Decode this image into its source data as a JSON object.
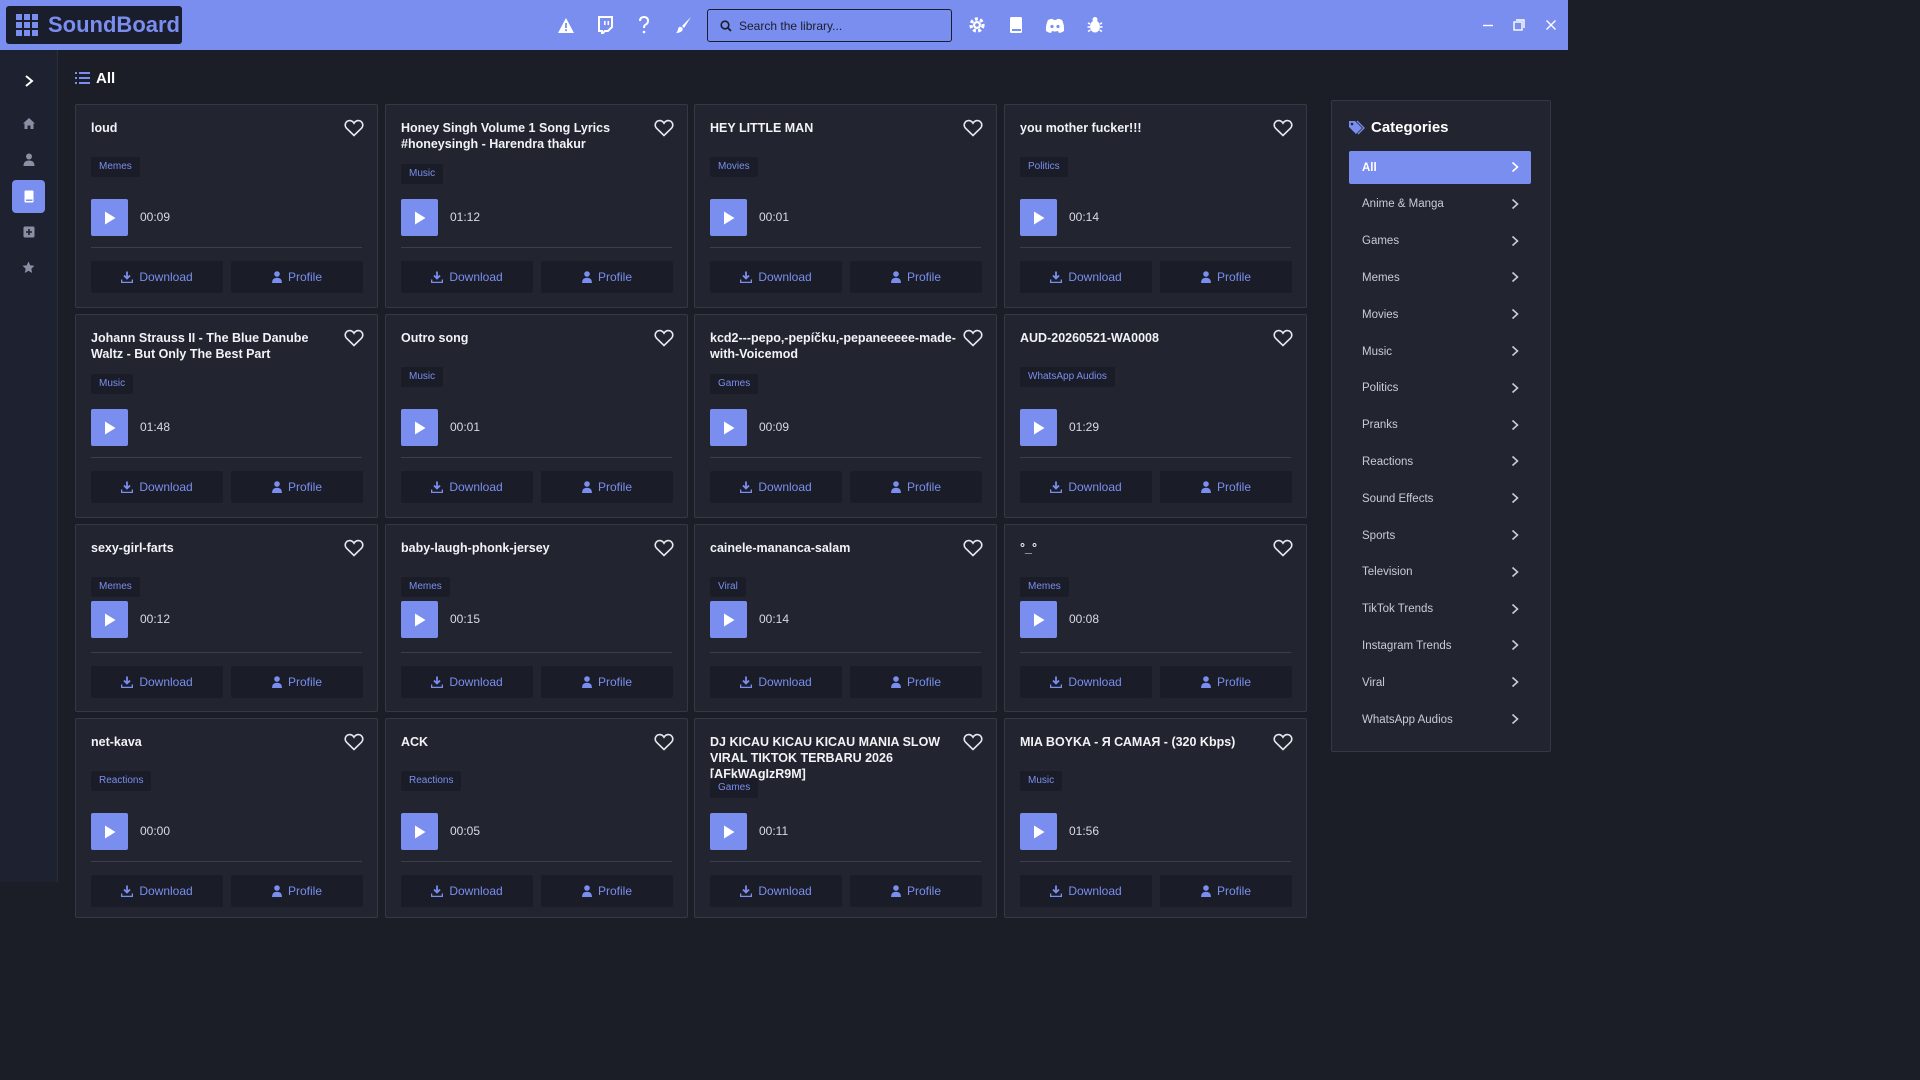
{
  "app": {
    "name": "SoundBoard"
  },
  "toolbar": {
    "icons": [
      "warning-icon",
      "twitch-icon",
      "help-icon",
      "brush-icon",
      "settings-icon",
      "book-icon",
      "discord-icon",
      "bug-icon"
    ],
    "search_placeholder": "Search the library..."
  },
  "window_controls": [
    "minimize",
    "restore",
    "close"
  ],
  "rail": {
    "items": [
      "home",
      "user",
      "library",
      "add",
      "favorites"
    ],
    "active": "library"
  },
  "page": {
    "heading": "All"
  },
  "card_labels": {
    "download": "Download",
    "profile": "Profile"
  },
  "cards": [
    {
      "title": "loud",
      "tag": "Memes",
      "duration": "00:09"
    },
    {
      "title": "Honey Singh Volume 1 Song Lyrics #honeysingh - Harendra thakur",
      "tag": "Music",
      "duration": "01:12"
    },
    {
      "title": "HEY LITTLE MAN",
      "tag": "Movies",
      "duration": "00:01"
    },
    {
      "title": "you mother fucker!!!",
      "tag": "Politics",
      "duration": "00:14"
    },
    {
      "title": "Johann Strauss II - The Blue Danube Waltz - But Only The Best Part",
      "tag": "Music",
      "duration": "01:48"
    },
    {
      "title": "Outro song",
      "tag": "Music",
      "duration": "00:01"
    },
    {
      "title": "kcd2---pepo,-pepíčku,-pepaneeeee-made-with-Voicemod",
      "tag": "Games",
      "duration": "00:09"
    },
    {
      "title": "AUD-20260521-WA0008",
      "tag": "WhatsApp Audios",
      "duration": "01:29"
    },
    {
      "title": "sexy-girl-farts",
      "tag": "Memes",
      "duration": "00:12"
    },
    {
      "title": "baby-laugh-phonk-jersey",
      "tag": "Memes",
      "duration": "00:15"
    },
    {
      "title": "cainele-mananca-salam",
      "tag": "Viral",
      "duration": "00:14"
    },
    {
      "title": "°_°",
      "tag": "Memes",
      "duration": "00:08"
    },
    {
      "title": "net-kava",
      "tag": "Reactions",
      "duration": "00:00"
    },
    {
      "title": "ACK",
      "tag": "Reactions",
      "duration": "00:05"
    },
    {
      "title": "DJ KICAU KICAU KICAU MANIA SLOW VIRAL TIKTOK TERBARU 2026 [AFkWAgIzR9M]",
      "tag": "Games",
      "duration": "00:11"
    },
    {
      "title": "MIA BOYKA - Я САМАЯ - (320 Kbps)",
      "tag": "Music",
      "duration": "01:56"
    }
  ],
  "categories": {
    "heading": "Categories",
    "items": [
      "All",
      "Anime & Manga",
      "Games",
      "Memes",
      "Movies",
      "Music",
      "Politics",
      "Pranks",
      "Reactions",
      "Sound Effects",
      "Sports",
      "Television",
      "TikTok Trends",
      "Instagram Trends",
      "Viral",
      "WhatsApp Audios"
    ],
    "active": "All"
  },
  "colors": {
    "accent": "#7a8ef0",
    "background": "#1b1e27",
    "card": "#22252f"
  }
}
